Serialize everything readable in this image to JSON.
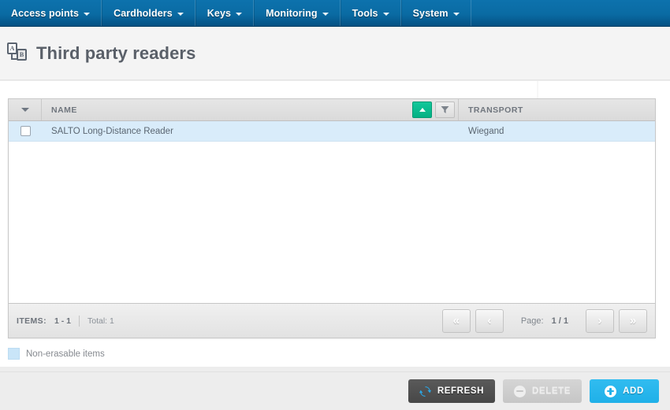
{
  "nav": {
    "items": [
      {
        "label": "Access points",
        "icon": "chevron-down-icon",
        "has_caret": true
      },
      {
        "label": "Cardholders",
        "icon": "chevron-down-icon",
        "has_caret": true
      },
      {
        "label": "Keys",
        "icon": "chevron-down-icon",
        "has_caret": true
      },
      {
        "label": "Monitoring",
        "icon": "chevron-down-icon",
        "has_caret": true
      },
      {
        "label": "Tools",
        "icon": "chevron-down-icon",
        "has_caret": true
      },
      {
        "label": "System",
        "icon": "chevron-down-icon",
        "has_caret": true
      }
    ]
  },
  "header": {
    "title": "Third party readers",
    "icon": "card-readers-icon",
    "icon_letters": {
      "first": "A",
      "second": "B"
    }
  },
  "grid": {
    "select_all_icon": "chevron-down-icon",
    "columns": [
      {
        "key": "name",
        "label": "NAME"
      },
      {
        "key": "transport",
        "label": "TRANSPORT"
      }
    ],
    "header_tools": {
      "sort_icon": "sort-ascending-icon",
      "sort_active": true,
      "filter_icon": "filter-funnel-icon"
    },
    "rows": [
      {
        "checked": false,
        "name": "SALTO Long-Distance Reader",
        "transport": "Wiegand"
      }
    ]
  },
  "footer": {
    "items_label": "ITEMS:",
    "items_range": "1 - 1",
    "total_label": "Total: 1",
    "page_label": "Page:",
    "page_value": "1 / 1",
    "pager": [
      {
        "name": "first-page-button",
        "glyph": "«"
      },
      {
        "name": "previous-page-button",
        "glyph": "‹"
      },
      {
        "name": "next-page-button",
        "glyph": "›"
      },
      {
        "name": "last-page-button",
        "glyph": "»"
      }
    ]
  },
  "legend": {
    "swatch_color": "#c9e5f8",
    "text": "Non-erasable items"
  },
  "actions": {
    "refresh": {
      "label": "REFRESH",
      "icon": "refresh-icon",
      "enabled": true
    },
    "delete": {
      "label": "DELETE",
      "icon": "minus-circle-icon",
      "enabled": false
    },
    "add": {
      "label": "ADD",
      "icon": "plus-circle-icon",
      "enabled": true
    }
  },
  "colors": {
    "nav_blue": "#0a6ba3",
    "accent_blue": "#22b1e9",
    "sort_green": "#03b183",
    "row_highlight": "#d9ecfa",
    "page_bg": "#ededed"
  }
}
